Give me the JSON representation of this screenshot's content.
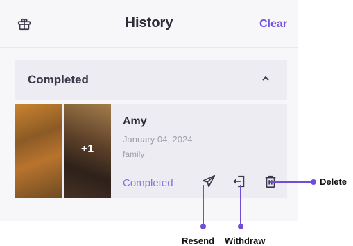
{
  "header": {
    "title": "History",
    "clear_label": "Clear",
    "icon": "gift-icon"
  },
  "section": {
    "label": "Completed",
    "icon": "chevron-up-icon"
  },
  "card": {
    "name": "Amy",
    "date": "January 04, 2024",
    "tag": "family",
    "more_count": "+1",
    "status": "Completed",
    "actions": [
      "send-icon",
      "withdraw-icon",
      "trash-icon"
    ]
  },
  "callouts": {
    "resend": "Resend",
    "withdraw": "Withdraw",
    "delete": "Delete"
  },
  "colors": {
    "accent": "#7355e0",
    "annotation": "#6f4ed8"
  }
}
